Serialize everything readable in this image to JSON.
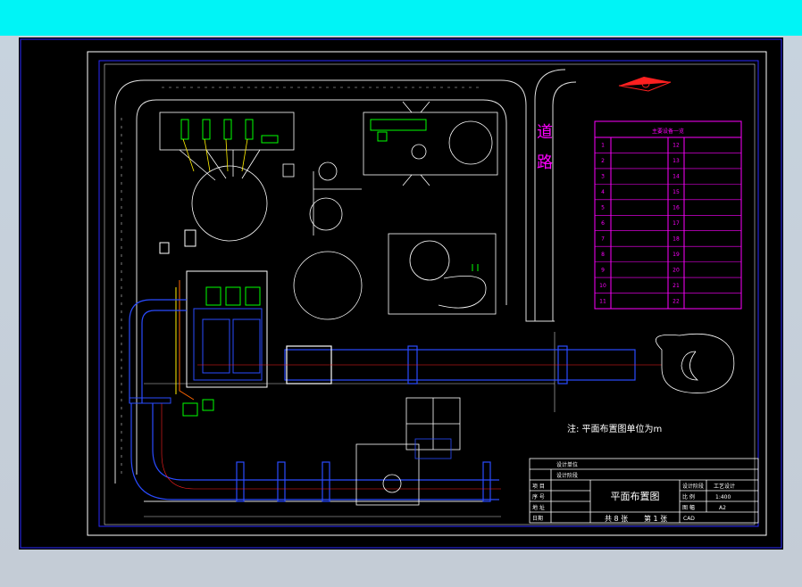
{
  "drawing": {
    "road_chars": [
      "道",
      "路"
    ],
    "note": "注: 平面布置图单位为m",
    "legend": {
      "title": "主要设备一览",
      "rows": [
        [
          "1",
          "",
          "12",
          ""
        ],
        [
          "2",
          "",
          "13",
          ""
        ],
        [
          "3",
          "",
          "14",
          ""
        ],
        [
          "4",
          "",
          "15",
          ""
        ],
        [
          "5",
          "",
          "16",
          ""
        ],
        [
          "6",
          "",
          "17",
          ""
        ],
        [
          "7",
          "",
          "18",
          ""
        ],
        [
          "8",
          "",
          "19",
          ""
        ],
        [
          "9",
          "",
          "20",
          ""
        ],
        [
          "10",
          "",
          "21",
          ""
        ],
        [
          "11",
          "",
          "22",
          ""
        ]
      ]
    },
    "title_block": {
      "design_unit": "设计单位",
      "design_stage": "设计阶段",
      "r_item": "项 目",
      "r_seq": "序 号",
      "r_addr": "地 址",
      "r_date": "日期",
      "sheet_title": "平面布置图",
      "stage_label": "设计阶段",
      "stage_value": "工艺设计",
      "scale_label": "比 例",
      "scale_value": "1:400",
      "size_label": "图 幅",
      "size_value": "A2",
      "total_sheets": "共 8 张",
      "sheet_no": "第 1 张",
      "code": "CAD"
    }
  },
  "colors": {
    "background": "#000000",
    "border": "#2a2aff",
    "road": "#e0e0e0",
    "equipment": "#ffffff",
    "kiln": "#2a4bff",
    "centerline": "#ff2020",
    "legend": "#ff00ff",
    "highlight": "#00ff00",
    "yellow": "#ffee00"
  }
}
